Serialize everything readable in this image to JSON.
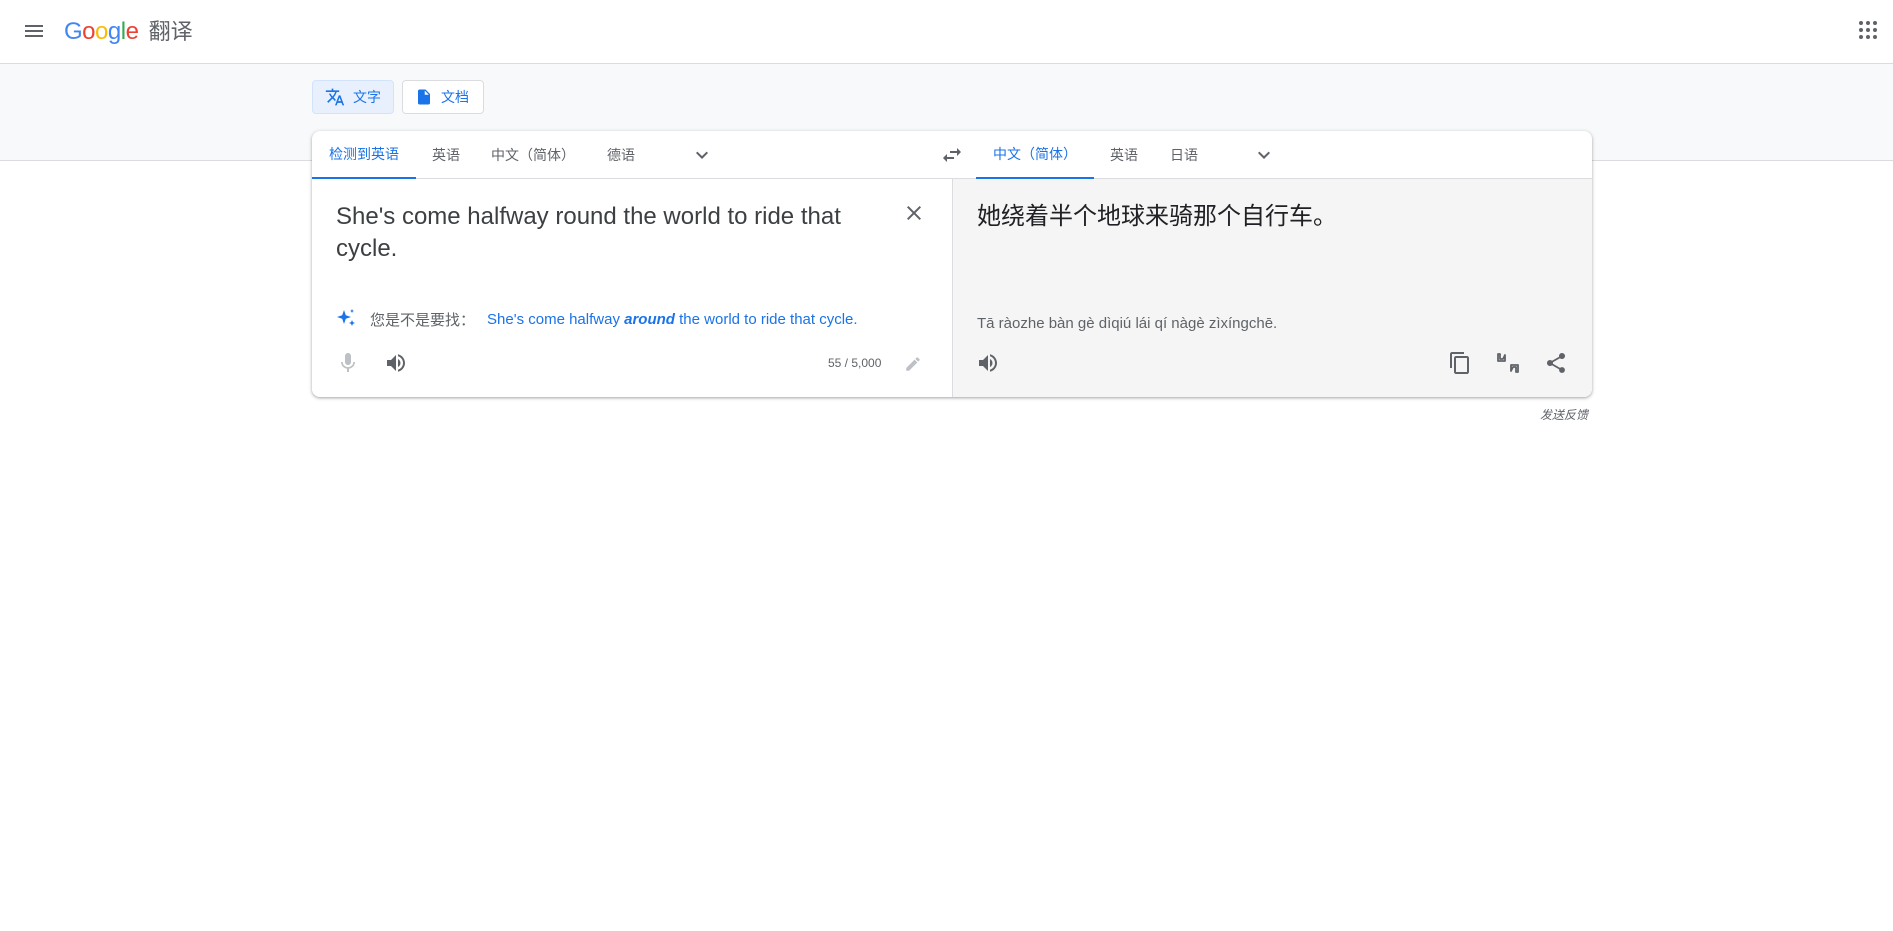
{
  "header": {
    "logo_letters": [
      "G",
      "o",
      "o",
      "g",
      "l",
      "e"
    ],
    "product_name": "翻译",
    "menu_icon": "menu-icon",
    "apps_icon": "apps-grid-icon"
  },
  "modes": {
    "text_label": "文字",
    "documents_label": "文档",
    "active": "text"
  },
  "source_langs": {
    "tabs": [
      "检测到英语",
      "英语",
      "中文（简体）",
      "德语"
    ],
    "active_index": 0
  },
  "target_langs": {
    "tabs": [
      "中文（简体）",
      "英语",
      "日语"
    ],
    "active_index": 0
  },
  "source": {
    "text": "She's come halfway round the world to ride that cycle.",
    "char_count": "55 / 5,000"
  },
  "suggestion": {
    "label": "您是不是要找：",
    "before": "She's come halfway ",
    "emphasis": "around",
    "after": " the world to ride that cycle."
  },
  "target": {
    "text": "她绕着半个地球来骑那个自行车。",
    "transliteration": "Tā ràozhe bàn gè dìqiú lái qí nàgè zìxíngchē."
  },
  "footer": {
    "feedback_label": "发送反馈"
  },
  "colors": {
    "accent": "#1a73e8",
    "target_bg": "#f5f5f5",
    "band_bg": "#f8f9fa",
    "border": "#dadce0"
  }
}
